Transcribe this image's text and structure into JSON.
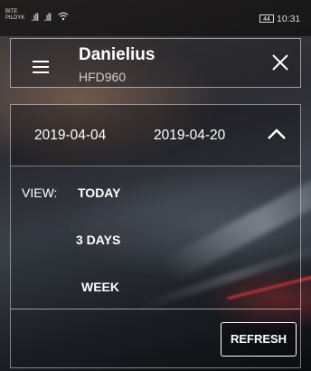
{
  "status_bar": {
    "carrier_line1": "BITE",
    "carrier_line2": "PILDYK",
    "signal1": ".ıll",
    "signal2": ".ıll",
    "battery": "44",
    "time": "10:31"
  },
  "header": {
    "name": "Danielius",
    "plate": "HFD960",
    "menu_icon": "hamburger-menu-icon",
    "close_icon": "close-icon"
  },
  "date_range": {
    "start": "2019-04-04",
    "end": "2019-04-20",
    "toggle_icon": "chevron-up-icon"
  },
  "view": {
    "label": "VIEW:",
    "options": [
      "TODAY",
      "3 DAYS",
      "WEEK"
    ]
  },
  "actions": {
    "refresh_label": "REFRESH"
  }
}
